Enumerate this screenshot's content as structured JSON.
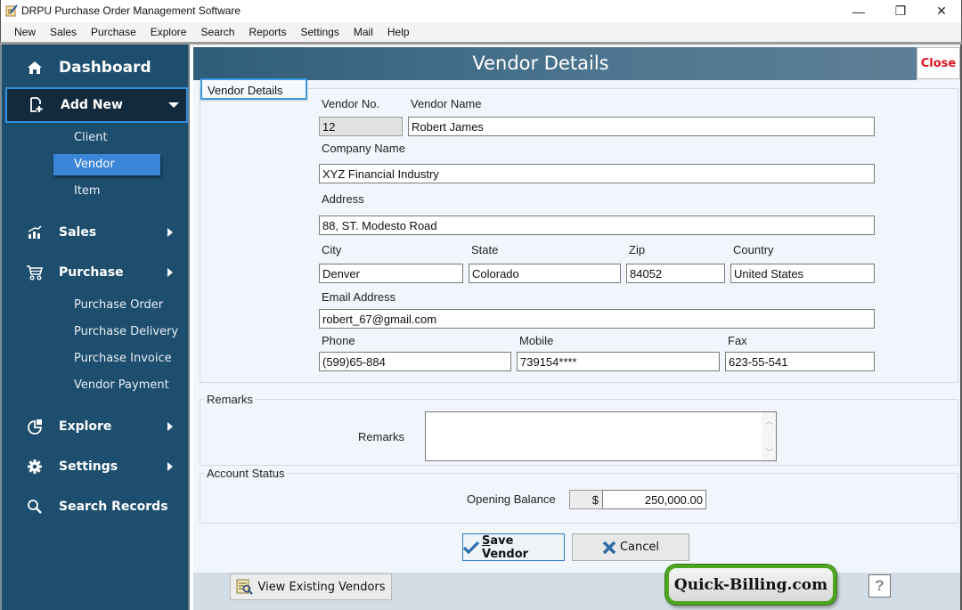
{
  "window": {
    "title": "DRPU Purchase Order Management Software",
    "controls": {
      "minimize": "—",
      "maximize": "❐",
      "close": "✕"
    }
  },
  "menu": [
    "New",
    "Sales",
    "Purchase",
    "Explore",
    "Search",
    "Reports",
    "Settings",
    "Mail",
    "Help"
  ],
  "sidebar": {
    "dashboard": "Dashboard",
    "add_new": "Add New",
    "add_new_items": [
      "Client",
      "Vendor",
      "Item"
    ],
    "active_item": "Vendor",
    "sales": "Sales",
    "purchase": "Purchase",
    "purchase_items": [
      "Purchase Order",
      "Purchase Delivery",
      "Purchase Invoice",
      "Vendor Payment"
    ],
    "explore": "Explore",
    "settings": "Settings",
    "search_records": "Search Records"
  },
  "header": {
    "title": "Vendor Details",
    "close_label": "Close"
  },
  "vendor_details": {
    "group_label": "Vendor Details",
    "vendor_no_label": "Vendor No.",
    "vendor_no": "12",
    "vendor_name_label": "Vendor Name",
    "vendor_name": "Robert James",
    "company_label": "Company Name",
    "company": "XYZ Financial Industry",
    "address_label": "Address",
    "address": "88, ST. Modesto Road",
    "city_label": "City",
    "city": "Denver",
    "state_label": "State",
    "state": "Colorado",
    "zip_label": "Zip",
    "zip": "84052",
    "country_label": "Country",
    "country": "United States",
    "email_label": "Email Address",
    "email": "robert_67@gmail.com",
    "phone_label": "Phone",
    "phone": "(599)65-884",
    "mobile_label": "Mobile",
    "mobile": "739154****",
    "fax_label": "Fax",
    "fax": "623-55-541"
  },
  "remarks": {
    "group_label": "Remarks",
    "field_label": "Remarks",
    "value": ""
  },
  "account_status": {
    "group_label": "Account Status",
    "opening_balance_label": "Opening Balance",
    "currency": "$",
    "opening_balance": "250,000.00"
  },
  "buttons": {
    "save": "Save Vendor",
    "cancel": "Cancel",
    "view_existing": "View Existing Vendors",
    "help": "?"
  },
  "branding": {
    "quick_billing": "Quick-Billing.com"
  },
  "colors": {
    "sidebar_bg": "#1d4e6e",
    "active_item": "#3a86d8",
    "accent_border": "#2f90de",
    "close_text": "#e0141c",
    "brand_green": "#4ea51f"
  }
}
